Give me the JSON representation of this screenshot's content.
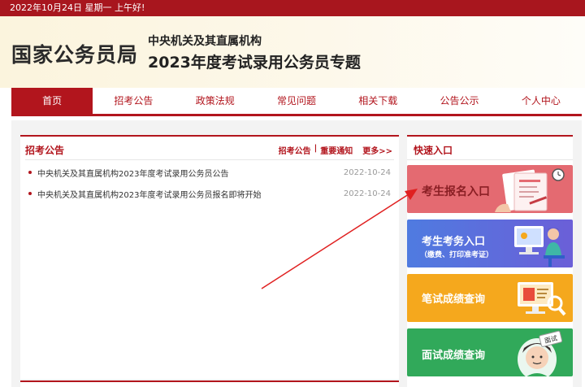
{
  "topbar": {
    "text": "2022年10月24日  星期一  上午好!"
  },
  "header": {
    "brand": "国家公务员局",
    "subtitle1": "中央机关及其直属机构",
    "subtitle2": "2023年度考试录用公务员专题"
  },
  "nav": {
    "items": [
      "首页",
      "招考公告",
      "政策法规",
      "常见问题",
      "相关下载",
      "公告公示",
      "个人中心"
    ]
  },
  "announcements": {
    "title": "招考公告",
    "link1": "招考公告",
    "separator": "|",
    "link2": "重要通知",
    "more": "更多>>",
    "items": [
      {
        "title": "中央机关及其直属机构2023年度考试录用公务员公告",
        "date": "2022-10-24"
      },
      {
        "title": "中央机关及其直属机构2023年度考试录用公务员报名即将开始",
        "date": "2022-10-24"
      }
    ]
  },
  "quick": {
    "title": "快速入口",
    "btn1": "考生报名入口",
    "btn2": "考生考务入口",
    "btn2_sub": "（缴费、打印准考证）",
    "btn3": "笔试成绩查询",
    "btn4": "面试成绩查询",
    "btn4_badge": "面试"
  },
  "colors": {
    "brand_red": "#b2151d",
    "accent_orange": "#f5a81d",
    "accent_green": "#31a95a",
    "accent_blue": "#5a72e0",
    "accent_pink": "#e46a71"
  }
}
